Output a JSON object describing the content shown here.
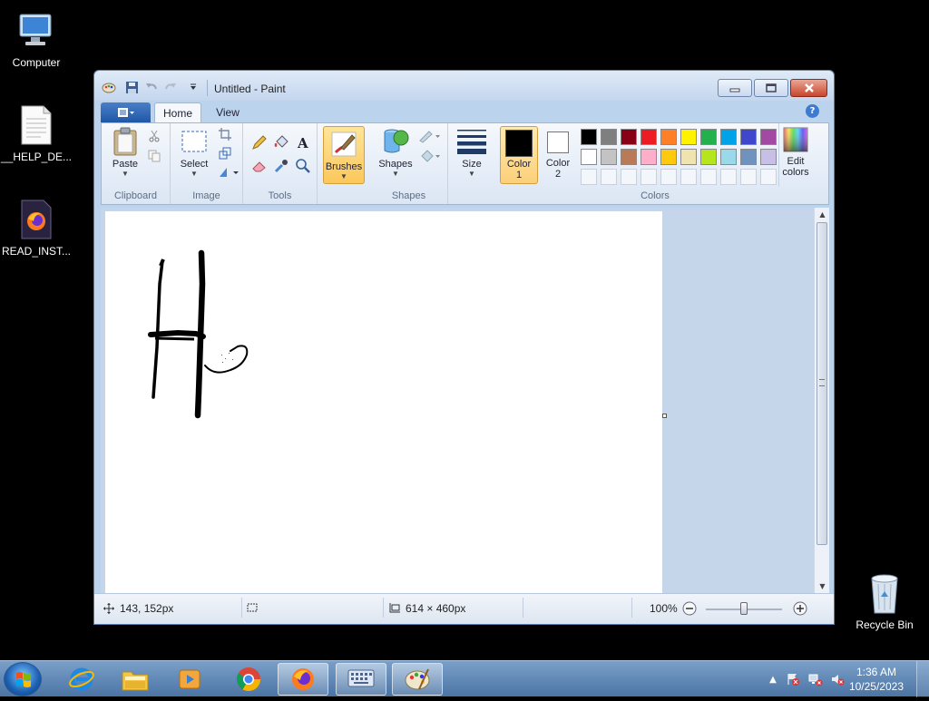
{
  "desktop": {
    "icons": [
      {
        "label": "Computer"
      },
      {
        "label": "__HELP_DE..."
      },
      {
        "label": "READ_INST..."
      },
      {
        "label": "Recycle Bin"
      }
    ]
  },
  "window": {
    "title": "Untitled - Paint",
    "tabs": [
      {
        "label": "Home"
      },
      {
        "label": "View"
      }
    ],
    "help": "?"
  },
  "ribbon": {
    "clipboard": {
      "label": "Clipboard",
      "paste": "Paste"
    },
    "image": {
      "label": "Image",
      "select": "Select"
    },
    "tools": {
      "label": "Tools"
    },
    "brushes": {
      "label": "Brushes"
    },
    "shapes": {
      "label": "Shapes",
      "shapes_btn": "Shapes"
    },
    "size": {
      "label": "Size"
    },
    "colors": {
      "label": "Colors",
      "color1_line1": "Color",
      "color1_line2": "1",
      "color2_line1": "Color",
      "color2_line2": "2",
      "edit_line1": "Edit",
      "edit_line2": "colors",
      "color1": "#000000",
      "color2": "#ffffff",
      "palette_row1": [
        "#000000",
        "#7f7f7f",
        "#880015",
        "#ed1c24",
        "#ff7f27",
        "#fff200",
        "#22b14c",
        "#00a2e8",
        "#3f48cc",
        "#a349a4"
      ],
      "palette_row2": [
        "#ffffff",
        "#c3c3c3",
        "#b97a57",
        "#ffaec9",
        "#ffc90e",
        "#efe4b0",
        "#b5e61d",
        "#99d9ea",
        "#7092be",
        "#c8bfe7"
      ]
    }
  },
  "status": {
    "cursor_pos": "143, 152px",
    "canvas_size": "614 × 460px",
    "zoom": "100%",
    "zoom_fraction": 0.5
  },
  "taskbar": {
    "time": "1:36 AM",
    "date": "10/25/2023"
  }
}
